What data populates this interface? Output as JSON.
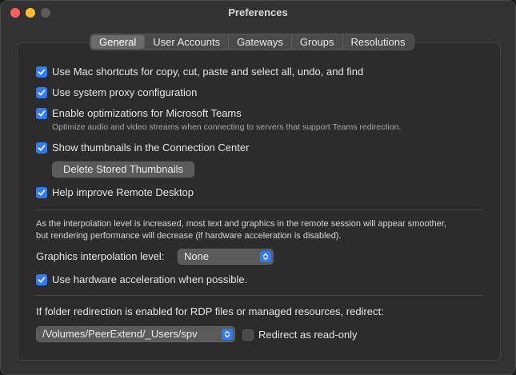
{
  "window": {
    "title": "Preferences"
  },
  "tabs": [
    "General",
    "User Accounts",
    "Gateways",
    "Groups",
    "Resolutions"
  ],
  "active_tab": "General",
  "options": {
    "mac_shortcuts": {
      "label": "Use Mac shortcuts for copy, cut, paste and select all, undo, and find",
      "checked": true
    },
    "system_proxy": {
      "label": "Use system proxy configuration",
      "checked": true
    },
    "teams_opt": {
      "label": "Enable optimizations for Microsoft Teams",
      "checked": true,
      "description": "Optimize audio and video streams when connecting to servers that support Teams redirection."
    },
    "thumbnails": {
      "label": "Show thumbnails in the Connection Center",
      "checked": true
    },
    "delete_thumbnails_button": "Delete Stored Thumbnails",
    "help_improve": {
      "label": "Help improve Remote Desktop",
      "checked": true
    }
  },
  "interpolation": {
    "description_line1": "As the interpolation level is increased, most text and graphics in the remote session will appear smoother,",
    "description_line2": "but rendering performance will decrease (if hardware acceleration is disabled).",
    "label": "Graphics interpolation level:",
    "selected": "None",
    "hw_accel": {
      "label": "Use hardware acceleration when possible.",
      "checked": true
    }
  },
  "redirection": {
    "description": "If folder redirection is enabled for RDP files or managed resources, redirect:",
    "path": "/Volumes/PeerExtend/_Users/spv",
    "read_only": {
      "label": "Redirect as read-only",
      "checked": false
    }
  },
  "colors": {
    "accent": "#2f7cf6",
    "close": "#ff5f57",
    "minimize": "#febc2e"
  }
}
